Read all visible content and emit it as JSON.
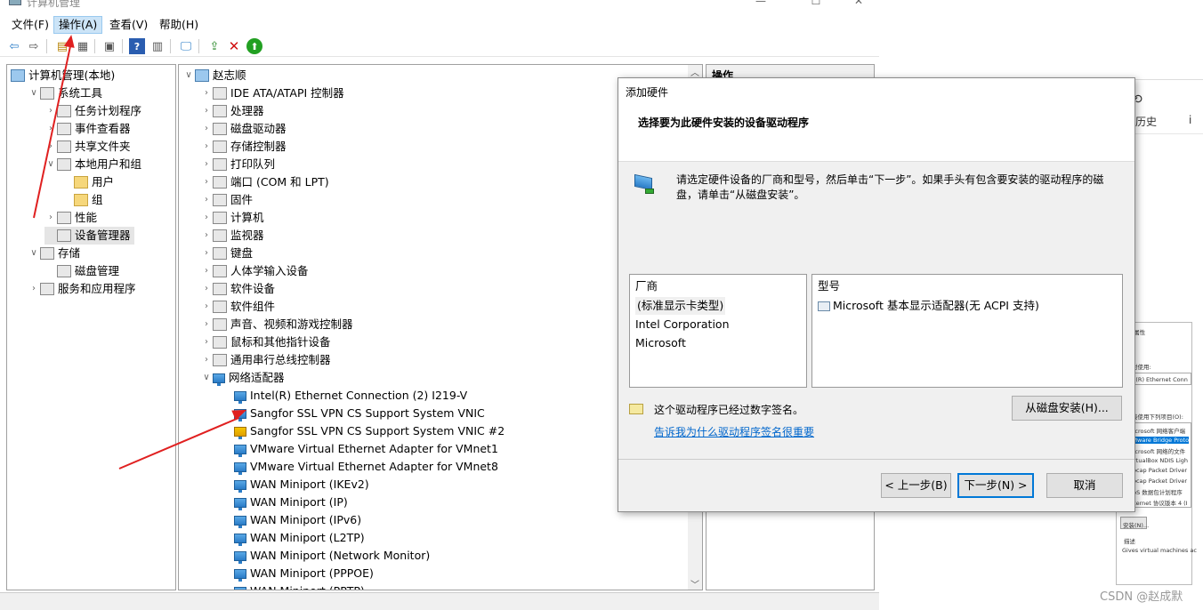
{
  "window": {
    "title": "计算机管理"
  },
  "menu": [
    "文件(F)",
    "操作(A)",
    "查看(V)",
    "帮助(H)"
  ],
  "tree": {
    "root": "计算机管理(本地)",
    "items": [
      {
        "label": "系统工具",
        "level": 1,
        "exp": "v"
      },
      {
        "label": "任务计划程序",
        "level": 2,
        "exp": ">"
      },
      {
        "label": "事件查看器",
        "level": 2,
        "exp": ">"
      },
      {
        "label": "共享文件夹",
        "level": 2,
        "exp": ">"
      },
      {
        "label": "本地用户和组",
        "level": 2,
        "exp": "v"
      },
      {
        "label": "用户",
        "level": 3,
        "exp": ""
      },
      {
        "label": "组",
        "level": 3,
        "exp": ""
      },
      {
        "label": "性能",
        "level": 2,
        "exp": ">"
      },
      {
        "label": "设备管理器",
        "level": 2,
        "exp": "",
        "sel": true
      },
      {
        "label": "存储",
        "level": 1,
        "exp": "v"
      },
      {
        "label": "磁盘管理",
        "level": 2,
        "exp": ""
      },
      {
        "label": "服务和应用程序",
        "level": 1,
        "exp": ">"
      }
    ]
  },
  "devices": {
    "root": "赵志顺",
    "categories": [
      "IDE ATA/ATAPI 控制器",
      "处理器",
      "磁盘驱动器",
      "存储控制器",
      "打印队列",
      "端口 (COM 和 LPT)",
      "固件",
      "计算机",
      "监视器",
      "键盘",
      "人体学输入设备",
      "软件设备",
      "软件组件",
      "声音、视频和游戏控制器",
      "鼠标和其他指针设备",
      "通用串行总线控制器",
      "网络适配器"
    ],
    "adapters": [
      "Intel(R) Ethernet Connection (2) I219-V",
      "Sangfor SSL VPN CS Support System VNIC",
      "Sangfor SSL VPN CS Support System VNIC #2",
      "VMware Virtual Ethernet Adapter for VMnet1",
      "VMware Virtual Ethernet Adapter for VMnet8",
      "WAN Miniport (IKEv2)",
      "WAN Miniport (IP)",
      "WAN Miniport (IPv6)",
      "WAN Miniport (L2TP)",
      "WAN Miniport (Network Monitor)",
      "WAN Miniport (PPPOE)",
      "WAN Miniport (PPTP)"
    ]
  },
  "actions_header": "操作",
  "dialog": {
    "title": "添加硬件",
    "heading": "选择要为此硬件安装的设备驱动程序",
    "instruction": "请选定硬件设备的厂商和型号，然后单击“下一步”。如果手头有包含要安装的驱动程序的磁盘，请单击“从磁盘安装”。",
    "manufacturer_header": "厂商",
    "manufacturers": [
      "(标准显示卡类型)",
      "Intel Corporation",
      "Microsoft"
    ],
    "model_header": "型号",
    "models": [
      "Microsoft 基本显示适配器(无 ACPI 支持)"
    ],
    "signed_text": "这个驱动程序已经过数字签名。",
    "signing_link": "告诉我为什么驱动程序签名很重要",
    "have_disk": "从磁盘安装(H)...",
    "back": "< 上一步(B)",
    "next": "下一步(N) >",
    "cancel": "取消"
  },
  "background": {
    "history_label": "历史",
    "props_title": "本网 属性",
    "props_tab": "共享",
    "props_connect": "连接时使用:",
    "props_adapter": "Intel(R) Ethernet Conn",
    "props_items_label": "此连接使用下列项目(O):",
    "props_items": [
      "Microsoft 网络客户端",
      "VMware Bridge Proto",
      "Microsoft 网络的文件",
      "VirtualBox NDIS Ligh",
      "Npcap Packet Driver",
      "Npcap Packet Driver",
      "QoS 数据包计划程序",
      "Internet 协议版本 4 (I"
    ],
    "props_install": "安装(N)...",
    "props_desc_label": "描述",
    "props_desc": "Gives virtual machines ac"
  },
  "watermark": "CSDN @赵成默"
}
